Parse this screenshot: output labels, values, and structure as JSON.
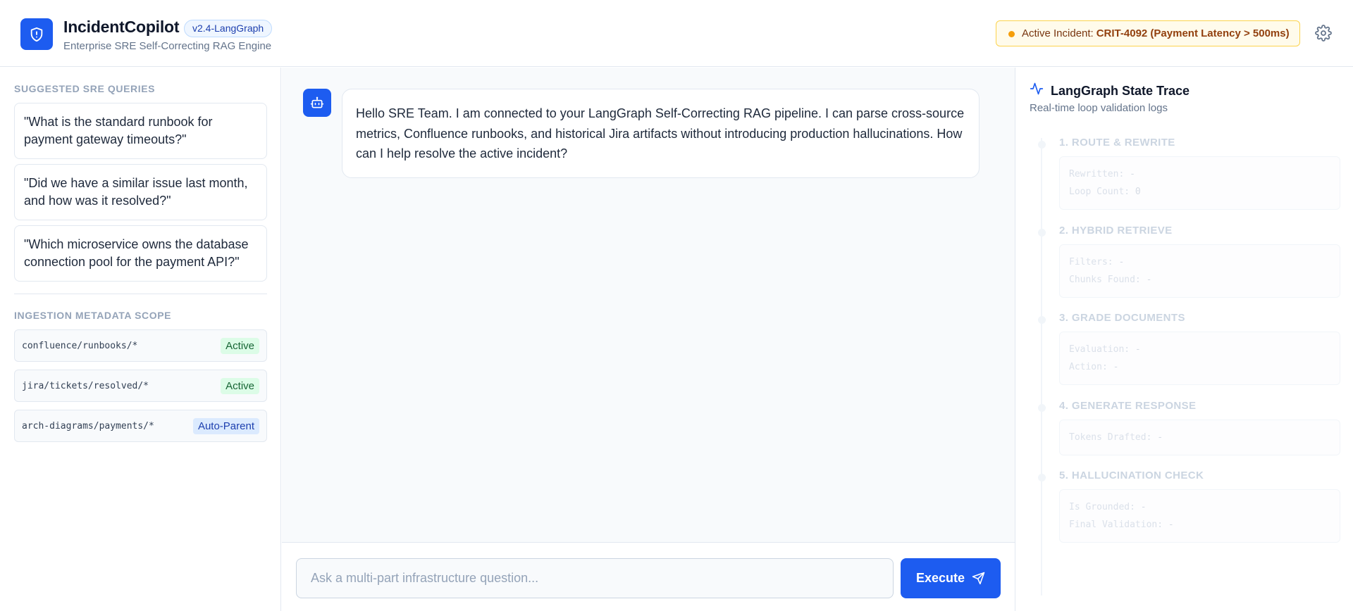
{
  "header": {
    "title": "IncidentCopilot",
    "version": "v2.4-LangGraph",
    "subtitle": "Enterprise SRE Self-Correcting RAG Engine",
    "incident_label": "Active Incident:",
    "incident_value": "CRIT-4092 (Payment Latency > 500ms)",
    "incident_dot_color": "#f59e0b",
    "settings_icon": "gear-icon"
  },
  "sidebar": {
    "queries_title": "SUGGESTED SRE QUERIES",
    "queries": [
      "\"What is the standard runbook for payment gateway timeouts?\"",
      "\"Did we have a similar issue last month, and how was it resolved?\"",
      "\"Which microservice owns the database connection pool for the payment API?\""
    ],
    "scope_title": "INGESTION METADATA SCOPE",
    "scopes": [
      {
        "path": "confluence/runbooks/*",
        "badge": "Active"
      },
      {
        "path": "jira/tickets/resolved/*",
        "badge": "Active"
      },
      {
        "path": "arch-diagrams/payments/*",
        "badge": "Auto-Parent"
      }
    ]
  },
  "chat": {
    "bot_icon": "bot-icon",
    "welcome": "Hello SRE Team. I am connected to your LangGraph Self-Correcting RAG pipeline. I can parse cross-source metrics, Confluence runbooks, and historical Jira artifacts without introducing production hallucinations. How can I help resolve the active incident?",
    "input_placeholder": "Ask a multi-part infrastructure question...",
    "input_value": "",
    "execute_label": "Execute",
    "accent_color": "#1d5cf0"
  },
  "trace": {
    "title": "LangGraph State Trace",
    "subtitle": "Real-time loop validation logs",
    "steps": [
      {
        "title": "1. ROUTE & REWRITE",
        "lines": [
          {
            "key": "Rewritten:",
            "value": "-"
          },
          {
            "key": "Loop Count:",
            "value": "0"
          }
        ]
      },
      {
        "title": "2. HYBRID RETRIEVE",
        "lines": [
          {
            "key": "Filters:",
            "value": "-"
          },
          {
            "key": "Chunks Found:",
            "value": "-"
          }
        ]
      },
      {
        "title": "3. GRADE DOCUMENTS",
        "lines": [
          {
            "key": "Evaluation:",
            "value": "-"
          },
          {
            "key": "Action:",
            "value": "-"
          }
        ]
      },
      {
        "title": "4. GENERATE RESPONSE",
        "lines": [
          {
            "key": "Tokens Drafted:",
            "value": "-"
          }
        ]
      },
      {
        "title": "5. HALLUCINATION CHECK",
        "lines": [
          {
            "key": "Is Grounded:",
            "value": "-"
          },
          {
            "key": "Final Validation:",
            "value": "-"
          }
        ]
      }
    ]
  }
}
